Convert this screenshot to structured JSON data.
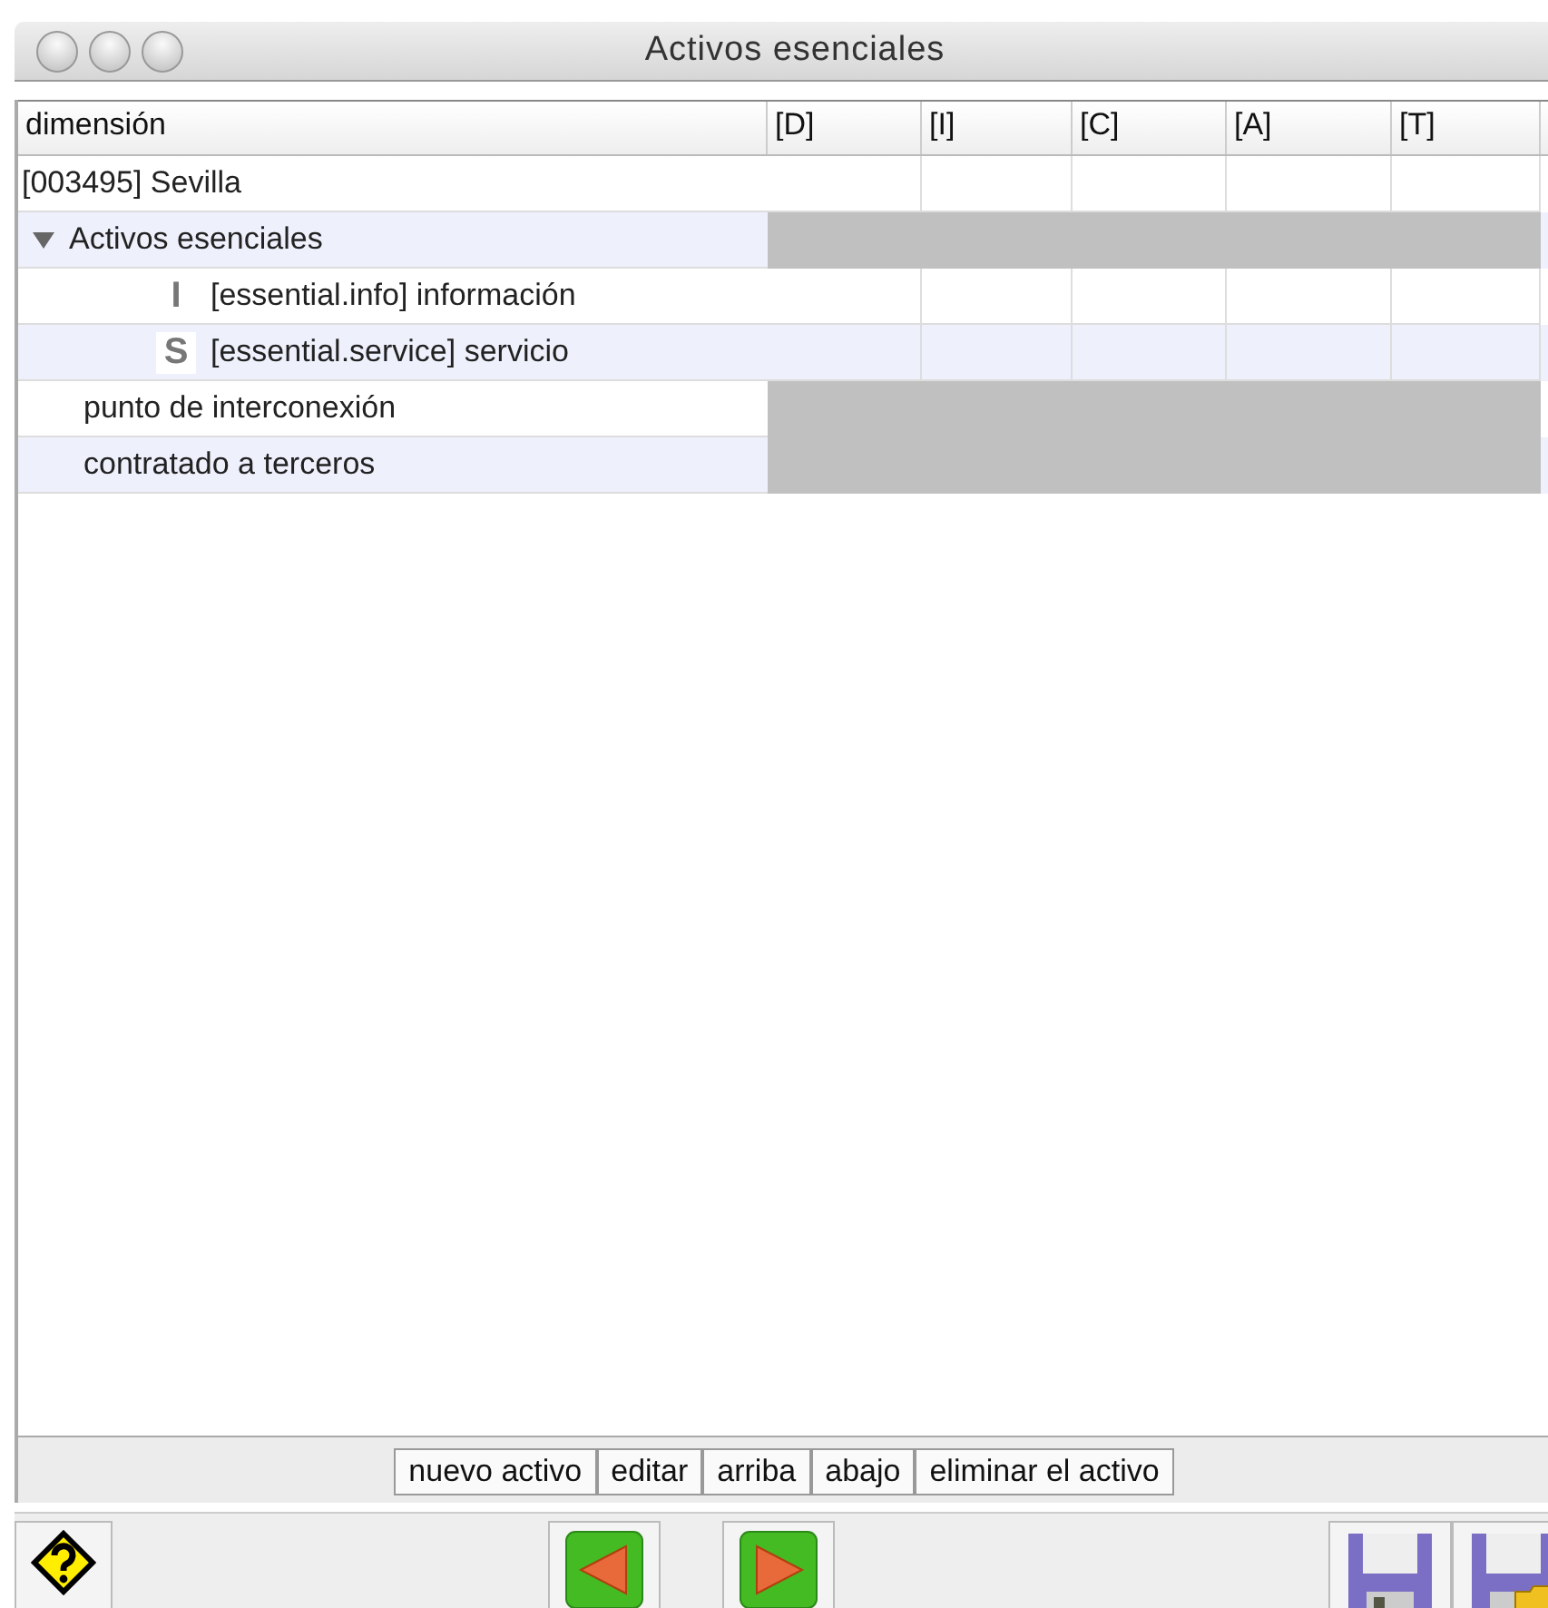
{
  "window": {
    "title": "Activos esenciales"
  },
  "table": {
    "columns": [
      "dimensión",
      "[D]",
      "[I]",
      "[C]",
      "[A]",
      "[T]"
    ],
    "rows": [
      {
        "kind": "root",
        "label": "[003495] Sevilla",
        "has_values": true,
        "children": [
          {
            "kind": "group",
            "label": "Activos esenciales",
            "expanded": true,
            "has_values": false,
            "children": [
              {
                "kind": "item",
                "badge": "I",
                "label": "[essential.info] información",
                "has_values": true
              },
              {
                "kind": "item",
                "badge": "S",
                "label": "[essential.service] servicio",
                "has_values": true
              }
            ]
          },
          {
            "kind": "plain",
            "label": "punto de interconexión",
            "has_values": false
          },
          {
            "kind": "plain",
            "label": "contratado a terceros",
            "has_values": false
          }
        ]
      }
    ]
  },
  "actions": [
    "nuevo activo",
    "editar",
    "arriba",
    "abajo",
    "eliminar el activo"
  ],
  "toolbar": [
    {
      "kind": "help"
    },
    {
      "kind": "back"
    },
    {
      "kind": "forward"
    },
    {
      "kind": "save"
    },
    {
      "kind": "save-as"
    }
  ]
}
